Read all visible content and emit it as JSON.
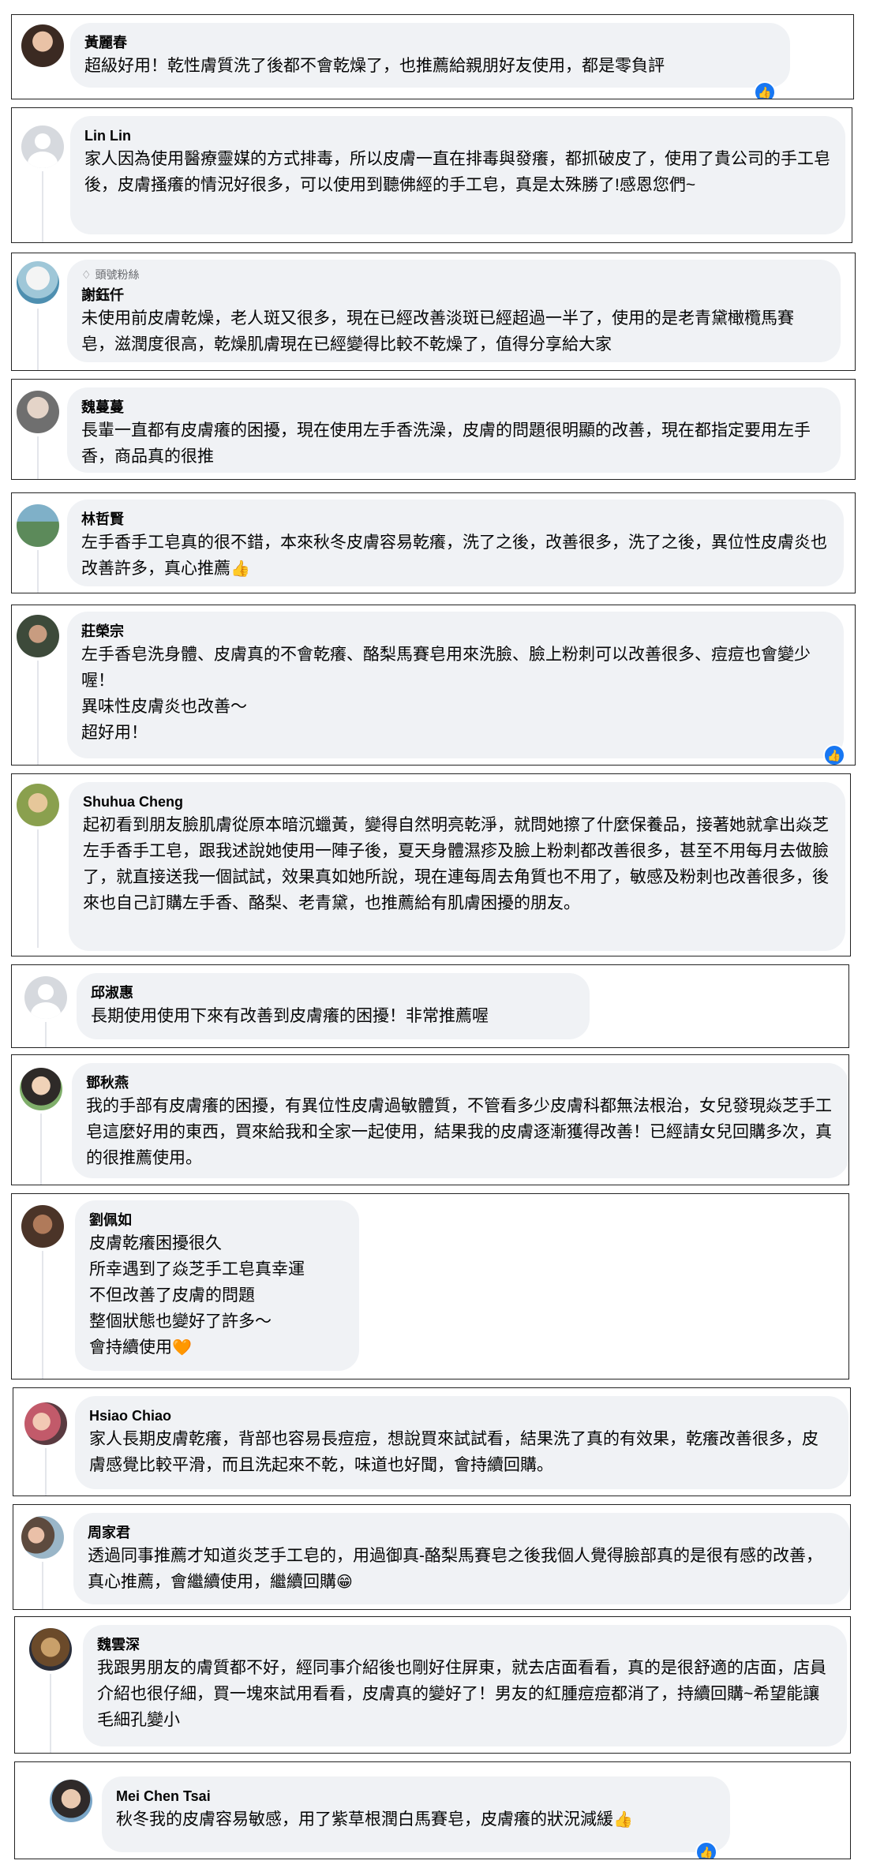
{
  "comments": [
    {
      "name": "黃麗春",
      "badge": "",
      "text": "超級好用！乾性膚質洗了後都不會乾燥了，也推薦給親朋好友使用，都是零負評",
      "emoji": ""
    },
    {
      "name": "Lin Lin",
      "badge": "",
      "text": "家人因為使用醫療靈媒的方式排毒，所以皮膚一直在排毒與發癢，都抓破皮了，使用了貴公司的手工皂後，皮膚搔癢的情況好很多，可以使用到聽佛經的手工皂，真是太殊勝了!感恩您們~",
      "emoji": ""
    },
    {
      "name": "謝鈺仟",
      "badge": "頭號粉絲",
      "text": "未使用前皮膚乾燥，老人斑又很多，現在已經改善淡斑已經超過一半了，使用的是老青黛橄欖馬賽皂，滋潤度很高，乾燥肌膚現在已經變得比較不乾燥了，值得分享給大家",
      "emoji": ""
    },
    {
      "name": "魏蔓蔓",
      "badge": "",
      "text": "長輩一直都有皮膚癢的困擾，現在使用左手香洗澡，皮膚的問題很明顯的改善，現在都指定要用左手香，商品真的很推",
      "emoji": ""
    },
    {
      "name": "林哲賢",
      "badge": "",
      "text": "左手香手工皂真的很不錯，本來秋冬皮膚容易乾癢，洗了之後，改善很多，洗了之後，異位性皮膚炎也改善許多，真心推薦",
      "emoji": "👍"
    },
    {
      "name": "莊榮宗",
      "badge": "",
      "text": "左手香皂洗身體、皮膚真的不會乾癢、酪梨馬賽皂用來洗臉、臉上粉刺可以改善很多、痘痘也會變少喔！\n異味性皮膚炎也改善～\n超好用！",
      "emoji": ""
    },
    {
      "name": "Shuhua Cheng",
      "badge": "",
      "text": "起初看到朋友臉肌膚從原本暗沉蠟黃，變得自然明亮乾淨，就問她擦了什麼保養品，接著她就拿出焱芝左手香手工皂，跟我述說她使用一陣子後，夏天身體濕疹及臉上粉刺都改善很多，甚至不用每月去做臉了，就直接送我一個試試，效果真如她所說，現在連每周去角質也不用了，敏感及粉刺也改善很多，後來也自己訂購左手香、酪梨、老青黛，也推薦給有肌膚困擾的朋友。",
      "emoji": ""
    },
    {
      "name": "邱淑惠",
      "badge": "",
      "text": "長期使用使用下來有改善到皮膚癢的困擾！非常推薦喔",
      "emoji": ""
    },
    {
      "name": "鄧秋燕",
      "badge": "",
      "text": "我的手部有皮膚癢的困擾，有異位性皮膚過敏體質，不管看多少皮膚科都無法根治，女兒發現焱芝手工皂這麼好用的東西，買來給我和全家一起使用，結果我的皮膚逐漸獲得改善！已經請女兒回購多次，真的很推薦使用。",
      "emoji": ""
    },
    {
      "name": "劉佩如",
      "badge": "",
      "text": "皮膚乾癢困擾很久\n所幸遇到了焱芝手工皂真幸運\n不但改善了皮膚的問題\n整個狀態也變好了許多～\n會持續使用",
      "emoji": "🧡"
    },
    {
      "name": "Hsiao Chiao",
      "badge": "",
      "text": "家人長期皮膚乾癢，背部也容易長痘痘，想說買來試試看，結果洗了真的有效果，乾癢改善很多，皮膚感覺比較平滑，而且洗起來不乾，味道也好聞，會持續回購。",
      "emoji": ""
    },
    {
      "name": "周家君",
      "badge": "",
      "text": "透過同事推薦才知道炎芝手工皂的，用過御真-酪梨馬賽皂之後我個人覺得臉部真的是很有感的改善，真心推薦，會繼續使用，繼續回購",
      "emoji": "😁"
    },
    {
      "name": "魏雲深",
      "badge": "",
      "text": "我跟男朋友的膚質都不好，經同事介紹後也剛好住屏東，就去店面看看，真的是很舒適的店面，店員介紹也很仔細，買一塊來試用看看，皮膚真的變好了！男友的紅腫痘痘都消了，持續回購~希望能讓毛細孔變小",
      "emoji": ""
    },
    {
      "name": "Mei Chen Tsai",
      "badge": "",
      "text": "秋冬我的皮膚容易敏感，用了紫草根潤白馬賽皂，皮膚癢的狀況減緩",
      "emoji": "👍"
    }
  ],
  "icons": {
    "like": "thumbs-up-icon",
    "badge": "diamond-icon"
  },
  "colors": {
    "bubble": "#f0f2f5",
    "like": "#1877f2",
    "name": "#050505",
    "badge": "#65676b"
  }
}
